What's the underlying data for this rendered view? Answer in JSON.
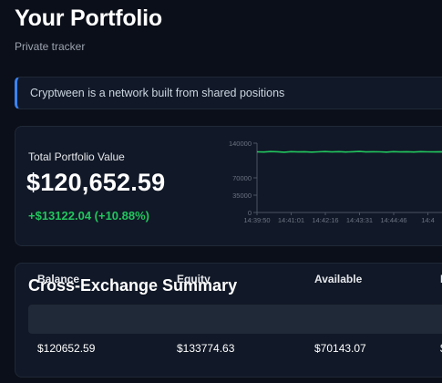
{
  "header": {
    "title": "Your Portfolio",
    "subtitle": "Private tracker"
  },
  "banner": {
    "text": "Cryptween is a network built from shared positions",
    "accent_color": "#3b82f6"
  },
  "portfolio": {
    "total_label": "Total Portfolio Value",
    "total_value": "$120,652.59",
    "change_text": "+$13122.04 (+10.88%)",
    "change_color": "#22c55e"
  },
  "chart_data": {
    "type": "line",
    "x": [
      "14:39:50",
      "14:41:01",
      "14:42:16",
      "14:43:31",
      "14:44:46",
      "14:4"
    ],
    "series": [
      {
        "values": [
          122500,
          122200,
          123100,
          122600,
          121800,
          122900,
          122300,
          122700,
          121900,
          122500,
          123000,
          122400,
          122800,
          122100,
          122600,
          123200,
          122300,
          122700,
          122500,
          122000,
          122900,
          122400,
          122600,
          122200,
          122800,
          122500,
          122300,
          122700,
          122400,
          122600
        ],
        "color": "#22c55e"
      }
    ],
    "y_ticks": [
      "140000",
      "70000",
      "35000",
      "0"
    ],
    "ylim": [
      0,
      140000
    ],
    "grid": false
  },
  "summary": {
    "title": "Cross-Exchange Summary",
    "columns": [
      "Balance",
      "Equity",
      "Available",
      "I"
    ],
    "row": [
      "$120652.59",
      "$133774.63",
      "$70143.07",
      "$"
    ]
  }
}
